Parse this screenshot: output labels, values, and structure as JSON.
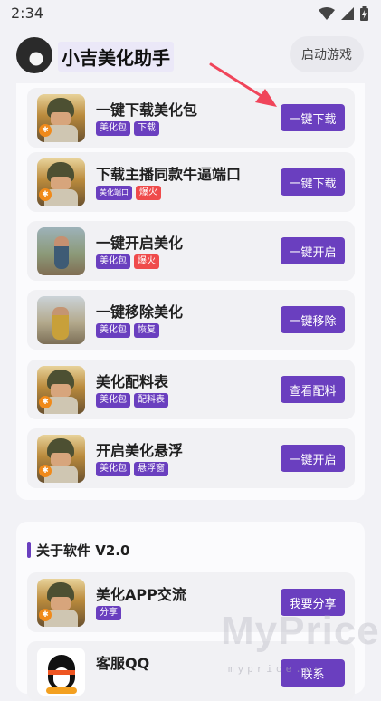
{
  "status_bar": {
    "time": "2:34",
    "icons": [
      "wifi-icon",
      "signal-icon",
      "battery-icon"
    ]
  },
  "header": {
    "title": "小吉美化助手",
    "launch_button": "启动游戏"
  },
  "items": [
    {
      "title": "一键下载美化包",
      "tags": [
        {
          "text": "美化包",
          "color": "purple"
        },
        {
          "text": "下载",
          "color": "purple"
        }
      ],
      "button": "一键下载",
      "thumb": "pubg"
    },
    {
      "title": "下载主播同款牛逼端口",
      "tags": [
        {
          "text": "美化端口",
          "color": "purple"
        },
        {
          "text": "爆火",
          "color": "red"
        }
      ],
      "button": "一键下载",
      "thumb": "pubg"
    },
    {
      "title": "一键开启美化",
      "tags": [
        {
          "text": "美化包",
          "color": "purple"
        },
        {
          "text": "爆火",
          "color": "red"
        }
      ],
      "button": "一键开启",
      "thumb": "photo1"
    },
    {
      "title": "一键移除美化",
      "tags": [
        {
          "text": "美化包",
          "color": "purple"
        },
        {
          "text": "恢复",
          "color": "purple"
        }
      ],
      "button": "一键移除",
      "thumb": "photo2"
    },
    {
      "title": "美化配料表",
      "tags": [
        {
          "text": "美化包",
          "color": "purple"
        },
        {
          "text": "配料表",
          "color": "purple"
        }
      ],
      "button": "查看配料",
      "thumb": "pubg"
    },
    {
      "title": "开启美化悬浮",
      "tags": [
        {
          "text": "美化包",
          "color": "purple"
        },
        {
          "text": "悬浮窗",
          "color": "purple"
        }
      ],
      "button": "一键开启",
      "thumb": "pubg"
    }
  ],
  "about": {
    "title": "关于软件 V2.0",
    "items": [
      {
        "title": "美化APP交流",
        "tags": [
          {
            "text": "分享",
            "color": "purple"
          }
        ],
        "button": "我要分享",
        "thumb": "pubg"
      },
      {
        "title": "客服QQ",
        "tags": [],
        "button": "联系",
        "thumb": "qq"
      }
    ]
  },
  "watermark": {
    "text": "MyPrice",
    "url": "myprice.cn"
  },
  "colors": {
    "accent": "#6a3fbf",
    "tag_red": "#ef4b4b",
    "background": "#f2f2f6"
  }
}
